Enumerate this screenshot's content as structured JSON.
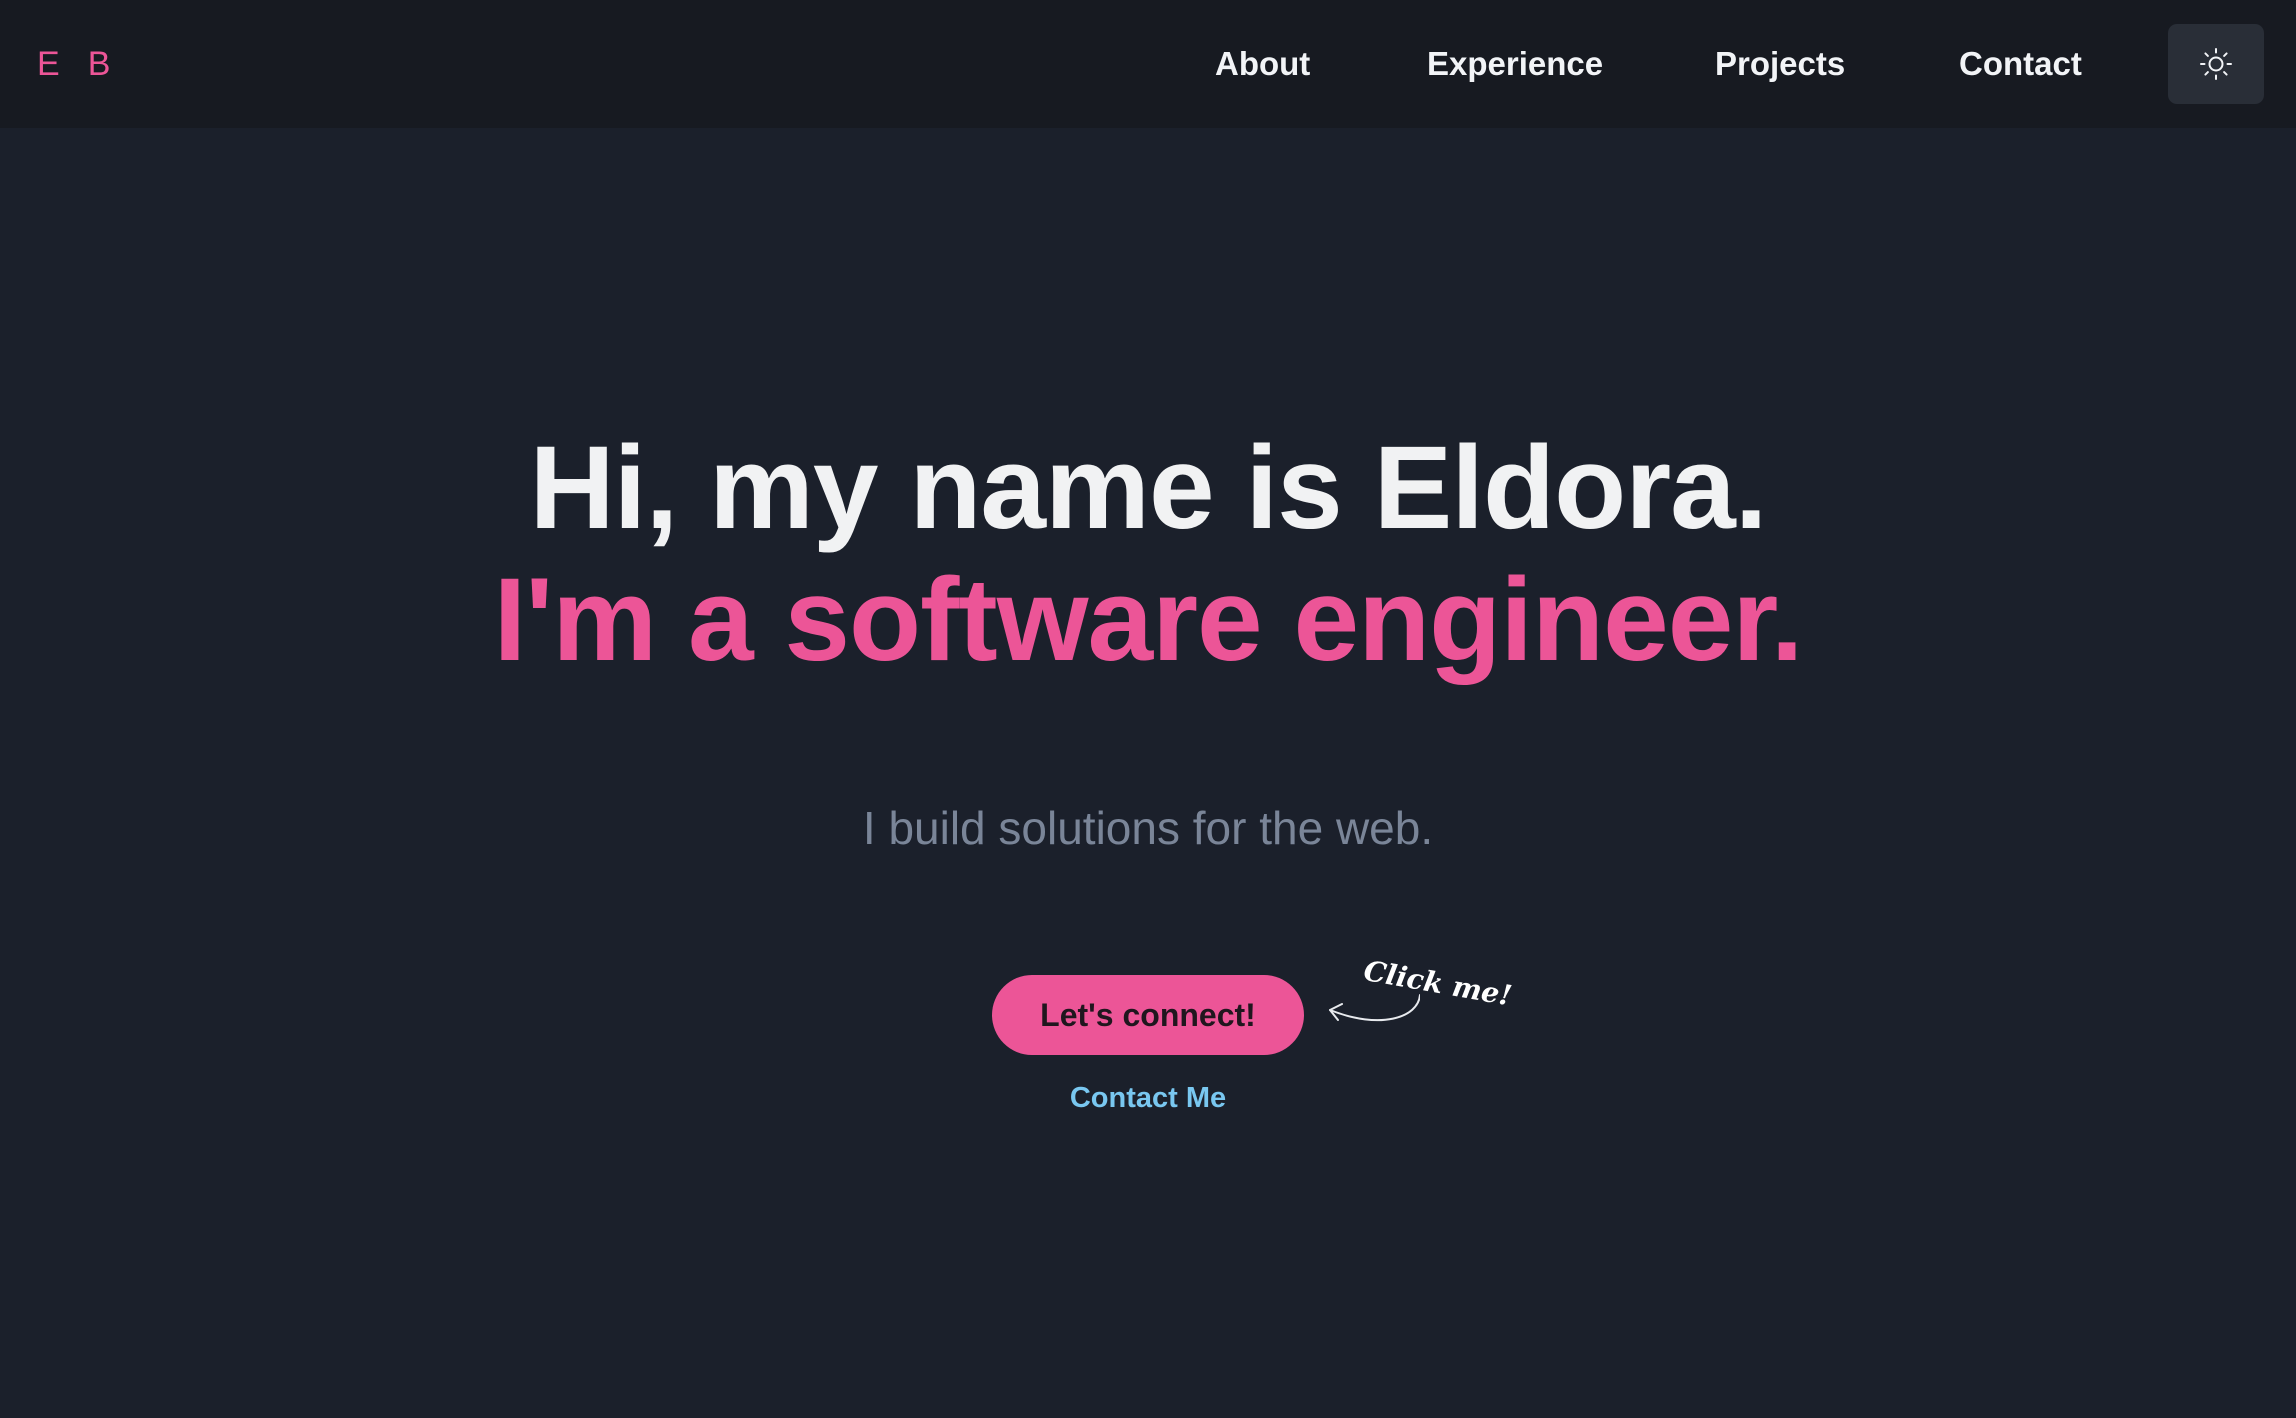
{
  "nav": {
    "logo": [
      "E",
      "B"
    ],
    "items": [
      {
        "label": "About"
      },
      {
        "label": "Experience"
      },
      {
        "label": "Projects"
      },
      {
        "label": "Contact"
      }
    ],
    "theme_toggle_icon": "sun-icon"
  },
  "hero": {
    "greeting": "Hi, my name is Eldora.",
    "role": "I'm a software engineer.",
    "tagline": "I build solutions for the web.",
    "cta_label": "Let's connect!",
    "hint": "Click me!",
    "hint_icon": "curved-arrow-icon",
    "contact_link": "Contact Me"
  },
  "colors": {
    "background": "#1b202b",
    "navbar": "#171a21",
    "accent": "#ec5597",
    "link": "#79c7f0",
    "muted_text": "#7a8598",
    "toggle_background": "#292e37"
  }
}
